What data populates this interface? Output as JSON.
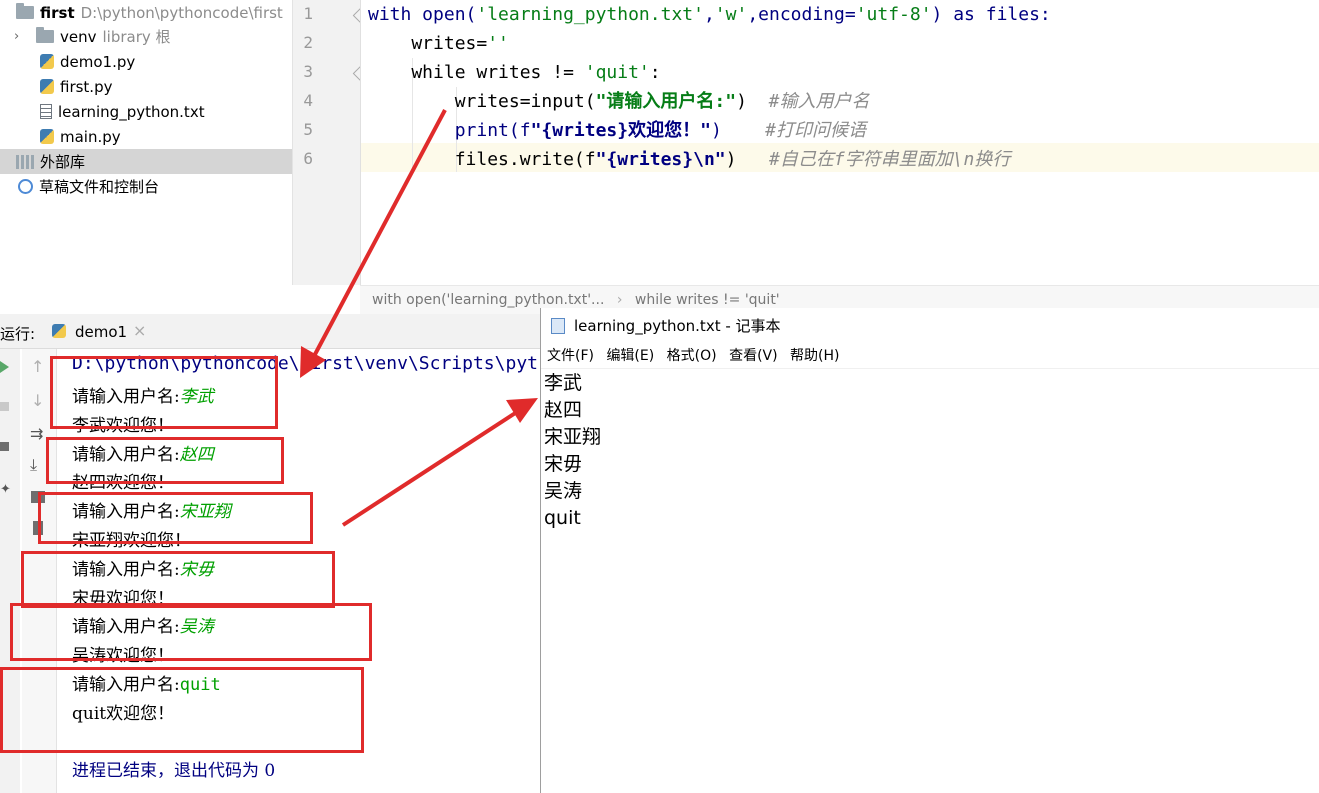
{
  "project": {
    "root_name": "first",
    "root_path": "D:\\python\\pythoncode\\first",
    "items": [
      {
        "label": "venv",
        "suffix": "library 根"
      },
      {
        "label": "demo1.py"
      },
      {
        "label": "first.py"
      },
      {
        "label": "learning_python.txt"
      },
      {
        "label": "main.py"
      },
      {
        "label": "外部库"
      },
      {
        "label": "草稿文件和控制台"
      }
    ]
  },
  "editor": {
    "line_numbers": [
      "1",
      "2",
      "3",
      "4",
      "5",
      "6"
    ],
    "lines": [
      {
        "p1": "with open(",
        "s1": "'learning_python.txt'",
        "p2": ",",
        "s2": "'w'",
        "p3": ",encoding=",
        "s3": "'utf-8'",
        "p4": ") as files:"
      },
      {
        "p1": "    writes=",
        "s1": "''"
      },
      {
        "p1": "    while writes != ",
        "s1": "'quit'",
        "p2": ":"
      },
      {
        "p1": "        writes=input(",
        "s1": "\"请输入用户名:\"",
        "p2": ")  ",
        "c": "#输入用户名"
      },
      {
        "p1": "        print(f",
        "s1": "\"{writes}欢迎您！\"",
        "p2": ")    ",
        "c": "#打印问候语"
      },
      {
        "p1": "        files.write(f",
        "s1": "\"{writes}\\n\"",
        "p2": ")   ",
        "c": "#自己在f字符串里面加\\n换行"
      }
    ],
    "breadcrumb": [
      "with open('learning_python.txt'...",
      "while writes != 'quit'"
    ]
  },
  "run": {
    "label": "运行:",
    "tab": "demo1",
    "path": "D:\\python\\pythoncode\\first\\venv\\Scripts\\pyt",
    "prompt": "请输入用户名:",
    "entries": [
      {
        "input": "李武",
        "greeting": "李武欢迎您！"
      },
      {
        "input": "赵四",
        "greeting": "赵四欢迎您！"
      },
      {
        "input": "宋亚翔",
        "greeting": "宋亚翔欢迎您！"
      },
      {
        "input": "宋毋",
        "greeting": "宋毋欢迎您！"
      },
      {
        "input": "吴涛",
        "greeting": "吴涛欢迎您！"
      },
      {
        "input": "quit",
        "greeting": "quit欢迎您！"
      }
    ],
    "exit": "进程已结束，退出代码为 0"
  },
  "notepad": {
    "title": "learning_python.txt - 记事本",
    "menu": [
      "文件(F)",
      "编辑(E)",
      "格式(O)",
      "查看(V)",
      "帮助(H)"
    ],
    "lines": [
      "李武",
      "赵四",
      "宋亚翔",
      "宋毋",
      "吴涛",
      "quit"
    ]
  },
  "colors": {
    "annotation": "#e02b2b",
    "string": "#067d17",
    "keyword": "#000080",
    "comment": "#8c8c8c"
  }
}
